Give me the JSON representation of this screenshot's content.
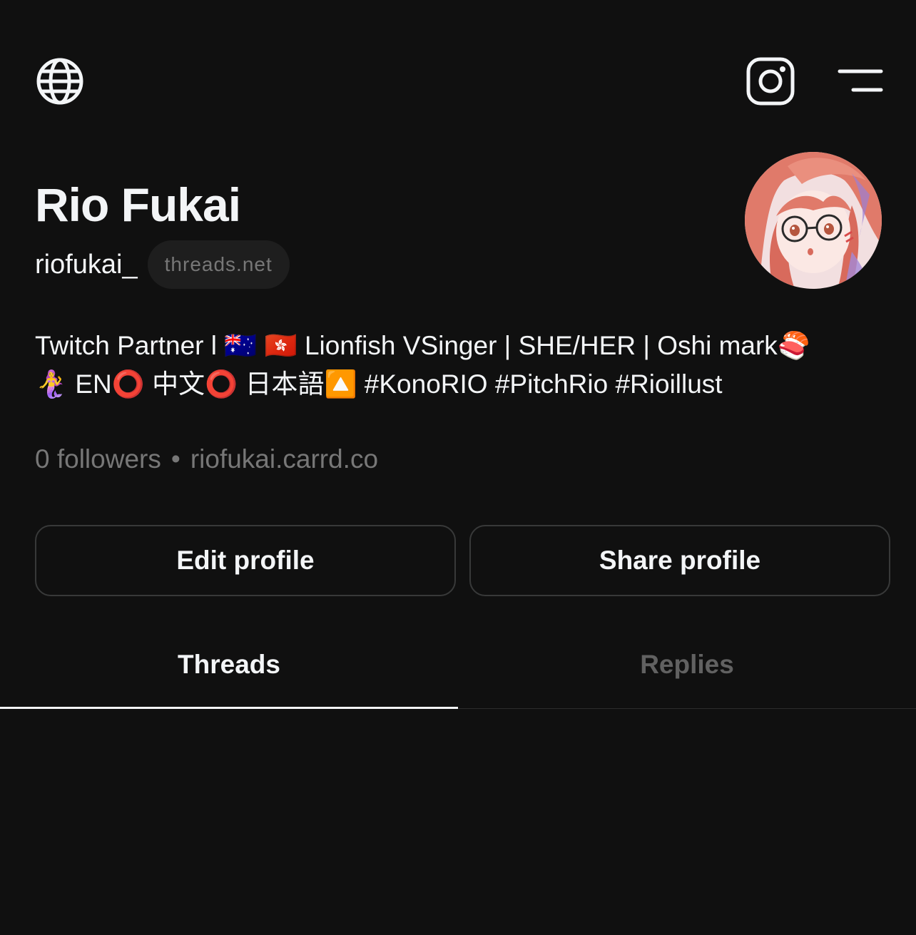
{
  "header": {
    "left_icon": "globe-icon",
    "right_icons": [
      "instagram-icon",
      "menu-icon"
    ]
  },
  "profile": {
    "display_name": "Rio Fukai",
    "username": "riofukai_",
    "domain_badge": "threads.net",
    "avatar": "avatar-illustration",
    "bio_line_1": "Twitch Partner l 🇦🇺 🇭🇰 Lionfish VSinger | SHE/HER | Oshi mark🍣",
    "bio_line_2": "🧜‍♀️ EN⭕ 中文⭕ 日本語🔼 #KonoRIO #PitchRio #Rioillust",
    "followers": "0 followers",
    "separator": "•",
    "link": "riofukai.carrd.co"
  },
  "actions": {
    "edit_label": "Edit profile",
    "share_label": "Share profile"
  },
  "tabs": [
    {
      "label": "Threads",
      "active": true
    },
    {
      "label": "Replies",
      "active": false
    }
  ],
  "colors": {
    "background": "#101010",
    "text_primary": "#f3f5f7",
    "text_secondary": "#777777",
    "border": "#383939"
  }
}
